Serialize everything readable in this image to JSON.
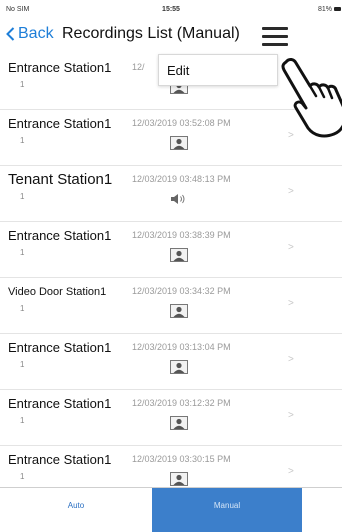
{
  "status_bar": {
    "carrier": "No SIM",
    "time": "15:55",
    "battery": "81%"
  },
  "nav": {
    "back_label": "Back",
    "title": "Recordings List (Manual)"
  },
  "menu": {
    "edit_label": "Edit"
  },
  "recordings": [
    {
      "station": "Entrance Station1",
      "number": "1",
      "datetime": "12/",
      "media": "image-icon"
    },
    {
      "station": "Entrance Station1",
      "number": "1",
      "datetime": "12/03/2019 03:52:08 PM",
      "media": "image-icon"
    },
    {
      "station": "Tenant Station1",
      "number": "1",
      "datetime": "12/03/2019 03:48:13 PM",
      "media": "speaker-icon"
    },
    {
      "station": "Entrance Station1",
      "number": "1",
      "datetime": "12/03/2019 03:38:39 PM",
      "media": "image-icon"
    },
    {
      "station": "Video Door Station1",
      "number": "1",
      "datetime": "12/03/2019 03:34:32 PM",
      "media": "image-icon"
    },
    {
      "station": "Entrance Station1",
      "number": "1",
      "datetime": "12/03/2019 03:13:04 PM",
      "media": "image-icon"
    },
    {
      "station": "Entrance Station1",
      "number": "1",
      "datetime": "12/03/2019 03:12:32 PM",
      "media": "image-icon"
    },
    {
      "station": "Entrance Station1",
      "number": "1",
      "datetime": "12/03/2019 03:30:15 PM",
      "media": "image-icon"
    }
  ],
  "tabs": {
    "auto": "Auto",
    "manual": "Manual"
  },
  "colors": {
    "accent": "#1e7ed8",
    "active_tab": "#3c7fcb"
  }
}
